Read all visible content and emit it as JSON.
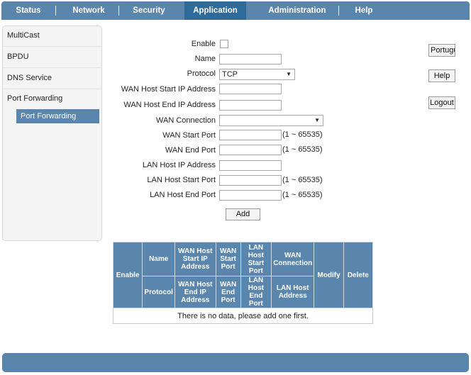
{
  "nav": {
    "tabs": [
      "Status",
      "Network",
      "Security",
      "Application",
      "Administration",
      "Help"
    ],
    "active": "Application"
  },
  "sidebar": {
    "items": [
      "MultiCast",
      "BPDU",
      "DNS Service",
      "Port Forwarding"
    ],
    "sub_item": "Port Forwarding"
  },
  "form": {
    "enable_label": "Enable",
    "name_label": "Name",
    "protocol_label": "Protocol",
    "protocol_value": "TCP",
    "wan_host_start_label": "WAN Host Start IP Address",
    "wan_host_end_label": "WAN Host End IP Address",
    "wan_connection_label": "WAN Connection",
    "wan_connection_value": "",
    "wan_start_port_label": "WAN Start Port",
    "wan_end_port_label": "WAN End Port",
    "lan_host_ip_label": "LAN Host IP Address",
    "lan_host_start_port_label": "LAN Host Start Port",
    "lan_host_end_port_label": "LAN Host End Port",
    "port_range": "(1 ~ 65535)",
    "add_button": "Add"
  },
  "right_buttons": {
    "language": "Portugu",
    "help": "Help",
    "logout": "Logout"
  },
  "table": {
    "enable": "Enable",
    "name": "Name",
    "wan_host_start": "WAN Host Start IP Address",
    "wan_start_port": "WAN Start Port",
    "lan_host_start_port": "LAN Host Start Port",
    "wan_connection": "WAN Connection",
    "modify": "Modify",
    "delete": "Delete",
    "protocol": "Protocol",
    "wan_host_end": "WAN Host End IP Address",
    "wan_end_port": "WAN End Port",
    "lan_host_end_port": "LAN Host End Port",
    "lan_host_address": "LAN Host Address",
    "empty_message": "There is no data, please add one first."
  }
}
